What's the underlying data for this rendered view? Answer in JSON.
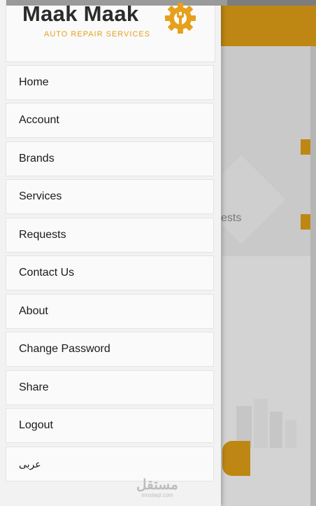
{
  "app": {
    "logo_title": "Maak Maak",
    "logo_subtitle": "AUTO REPAIR SERVICES"
  },
  "menu": [
    {
      "label": "Home"
    },
    {
      "label": "Account"
    },
    {
      "label": "Brands"
    },
    {
      "label": "Services"
    },
    {
      "label": "Requests"
    },
    {
      "label": "Contact Us"
    },
    {
      "label": "About"
    },
    {
      "label": "Change Password"
    },
    {
      "label": "Share"
    },
    {
      "label": "Logout"
    },
    {
      "label": "عربى"
    }
  ],
  "background": {
    "partial_text": "ests"
  },
  "watermark": {
    "main": "مستقل",
    "sub": "mostaql.com"
  },
  "colors": {
    "brand_orange": "#d99a16",
    "logo_dark": "#2b2b2b"
  }
}
